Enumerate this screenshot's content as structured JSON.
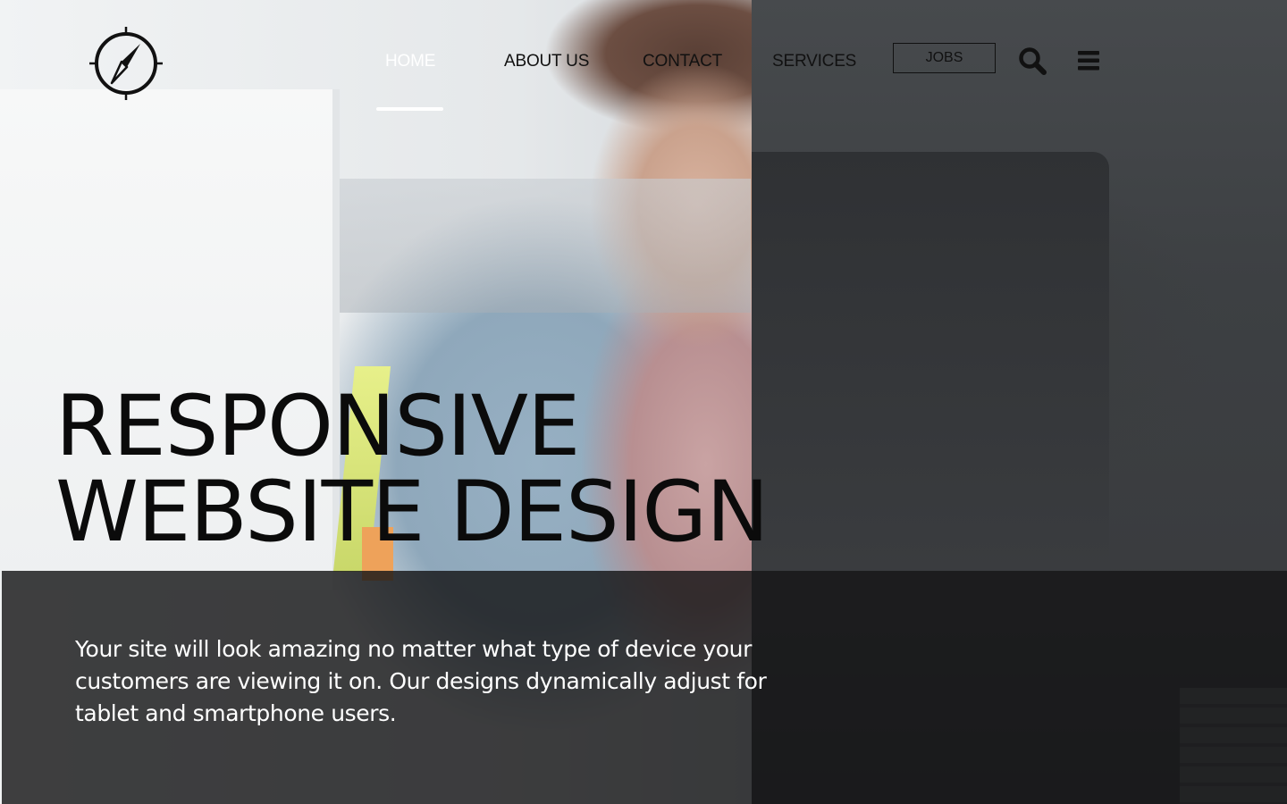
{
  "nav": {
    "items": [
      {
        "label": "HOME",
        "active": true
      },
      {
        "label": "ABOUT US",
        "active": false
      },
      {
        "label": "CONTACT",
        "active": false
      },
      {
        "label": "SERVICES",
        "active": false
      }
    ],
    "jobs_label": "JOBS",
    "icons": [
      "compass-logo-icon",
      "search-icon",
      "hamburger-menu-icon"
    ]
  },
  "hero": {
    "title_line1": "RESPONSIVE",
    "title_line2": "WEBSITE DESIGN",
    "description": "Your site will look amazing no matter what type of device your customers are viewing it on. Our designs dynamically adjust for tablet and smartphone users."
  },
  "colors": {
    "text_dark": "#0b0b0b",
    "text_light": "#ffffff",
    "panel_dark": "#161617",
    "overlay_gray": "#3d4043"
  }
}
